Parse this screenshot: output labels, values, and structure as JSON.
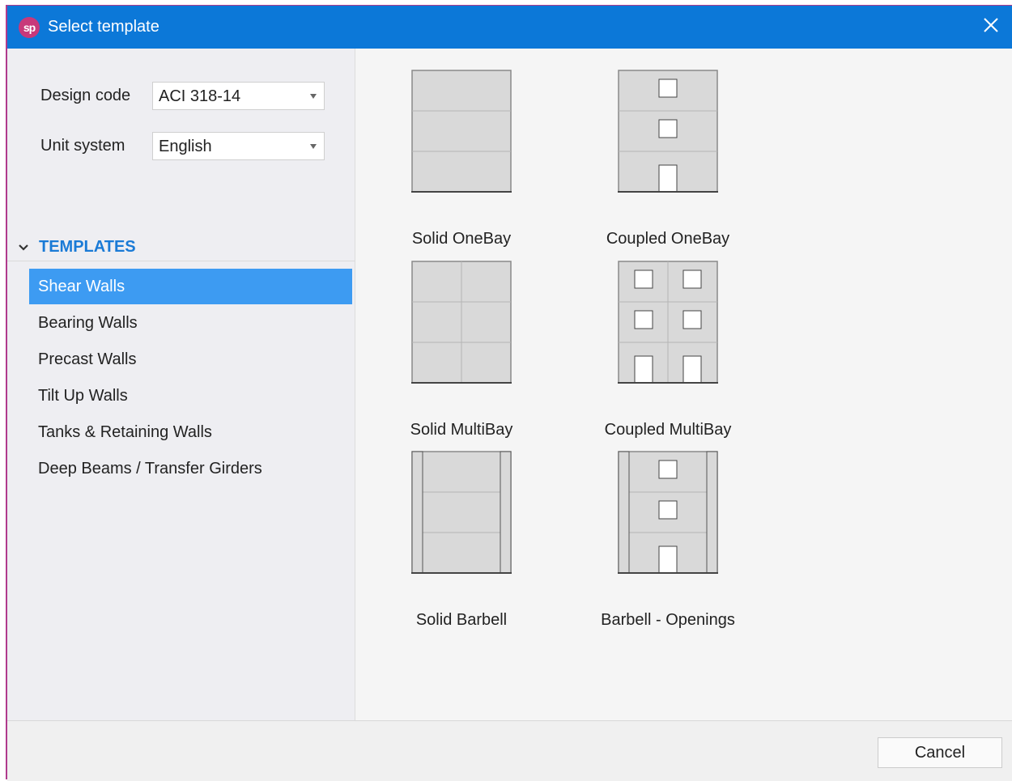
{
  "window": {
    "title": "Select template",
    "logo_text": "sp"
  },
  "form": {
    "design_code_label": "Design code",
    "design_code_value": "ACI 318-14",
    "unit_system_label": "Unit system",
    "unit_system_value": "English"
  },
  "templates": {
    "header": "TEMPLATES",
    "items": [
      {
        "label": "Shear Walls",
        "selected": true
      },
      {
        "label": "Bearing Walls",
        "selected": false
      },
      {
        "label": "Precast Walls",
        "selected": false
      },
      {
        "label": "Tilt Up Walls",
        "selected": false
      },
      {
        "label": "Tanks & Retaining Walls",
        "selected": false
      },
      {
        "label": "Deep Beams / Transfer Girders",
        "selected": false
      }
    ]
  },
  "gallery": [
    {
      "label": "Solid OneBay"
    },
    {
      "label": "Coupled OneBay"
    },
    {
      "label": "Solid MultiBay"
    },
    {
      "label": "Coupled MultiBay"
    },
    {
      "label": "Solid Barbell"
    },
    {
      "label": "Barbell - Openings"
    }
  ],
  "footer": {
    "cancel_label": "Cancel"
  },
  "colors": {
    "titlebar": "#0c78d8",
    "selection": "#3d9bf2",
    "accent": "#1a7ad6"
  },
  "icons": {
    "close": "close-icon",
    "dropdown": "caret-down-icon",
    "collapse": "chevron-down-icon"
  }
}
